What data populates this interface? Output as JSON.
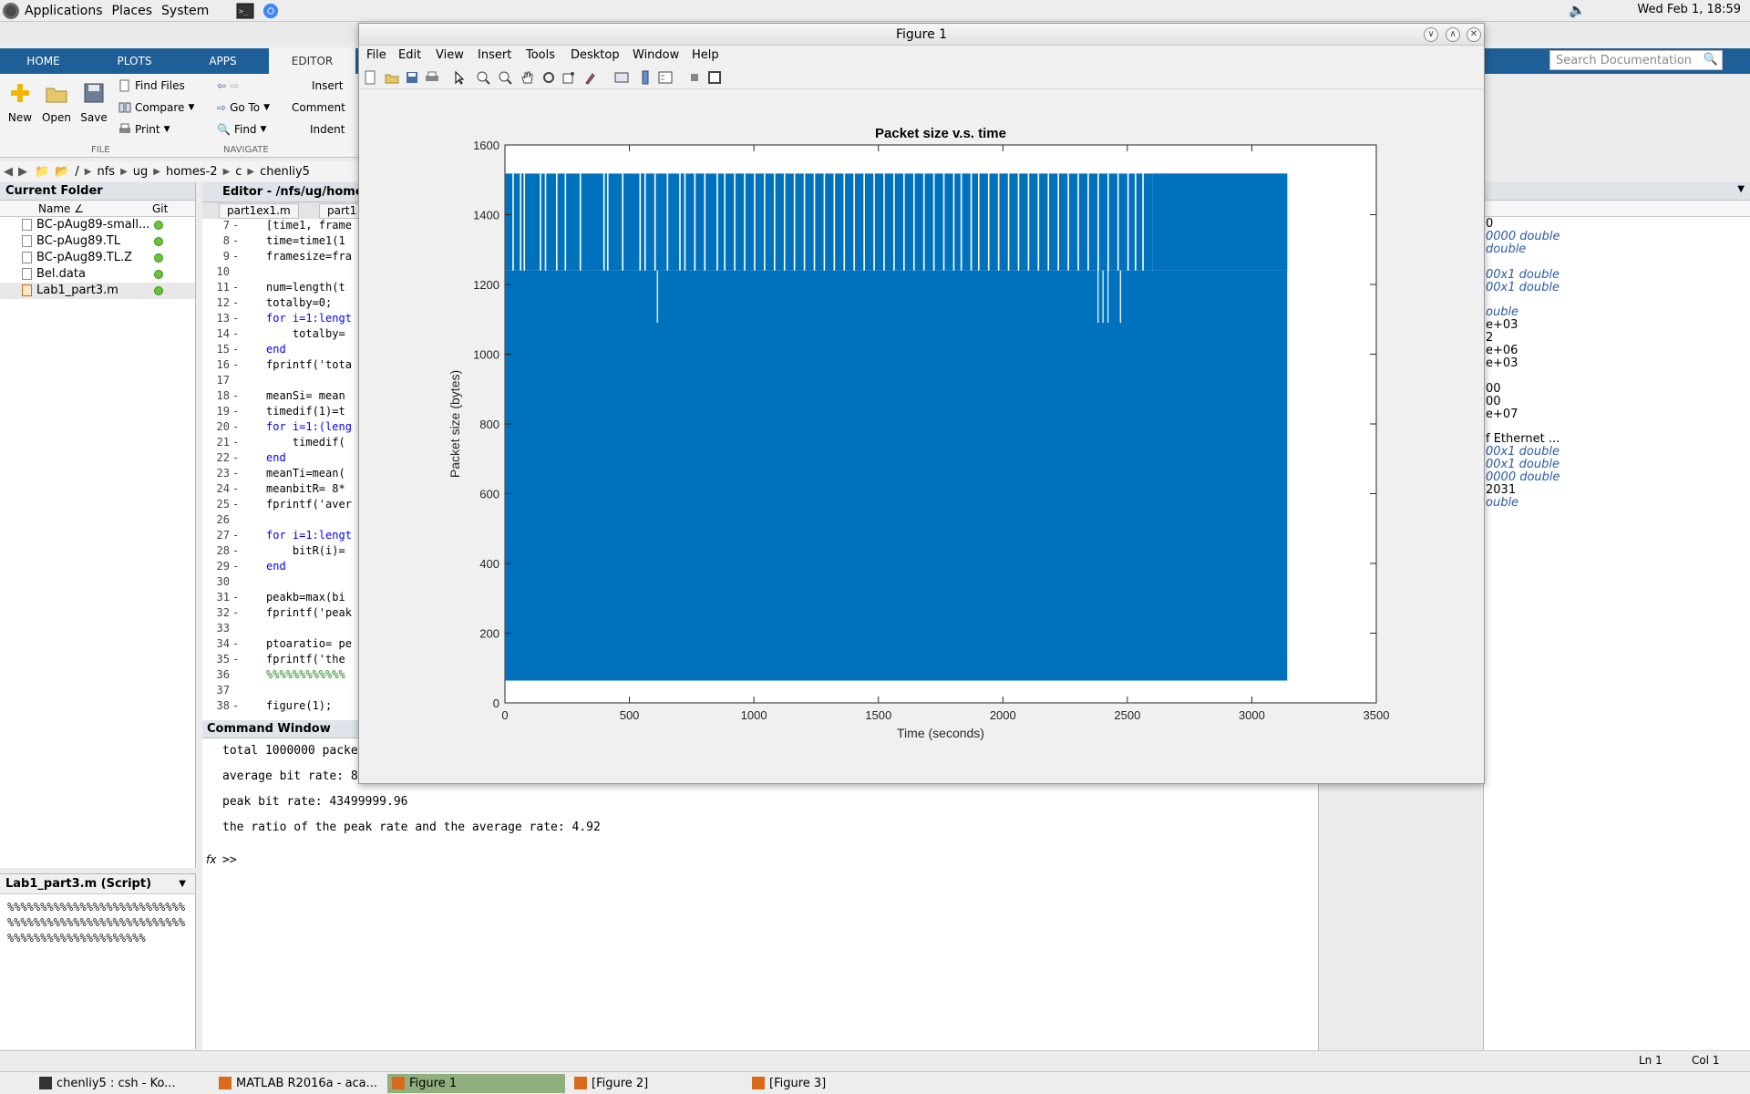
{
  "panel": {
    "applications": "Applications",
    "places": "Places",
    "system": "System",
    "clock": "Wed Feb  1, 18:59"
  },
  "ribbon": {
    "tabs": [
      "HOME",
      "PLOTS",
      "APPS",
      "EDITOR"
    ],
    "new_label": "New",
    "open_label": "Open",
    "save_label": "Save",
    "find_files": "Find Files",
    "compare": "Compare",
    "print": "Print",
    "go_to": "Go To",
    "find": "Find",
    "insert": "Insert",
    "comment": "Comment",
    "indent": "Indent",
    "group_file": "FILE",
    "group_navigate": "NAVIGATE"
  },
  "address": {
    "crumbs": [
      "/",
      "nfs",
      "ug",
      "homes-2",
      "c",
      "chenliy5"
    ]
  },
  "current_folder": {
    "title": "Current Folder",
    "col_name": "Name ∠",
    "col_git": "Git",
    "files": [
      "BC-pAug89-small...",
      "BC-pAug89.TL",
      "BC-pAug89.TL.Z",
      "Bel.data",
      "Lab1_part3.m"
    ]
  },
  "details": {
    "title": "Lab1_part3.m  (Script)",
    "content": "%%%%%%%%%%%%%%%%%%%%%%%%%%%%%%%%%%%%%%%%%%%%%%%%%%%%%%%%%%%%%%%%%%%%%%%%%%%"
  },
  "editor": {
    "title": "Editor - /nfs/ug/home",
    "tabs": [
      "part1ex1.m",
      "part1"
    ],
    "lines": [
      {
        "n": "7",
        "d": "-",
        "code": "[time1, frame"
      },
      {
        "n": "8",
        "d": "-",
        "code": "time=time1(1"
      },
      {
        "n": "9",
        "d": "-",
        "code": "framesize=fra"
      },
      {
        "n": "10",
        "d": "",
        "code": ""
      },
      {
        "n": "11",
        "d": "-",
        "code": "num=length(t"
      },
      {
        "n": "12",
        "d": "-",
        "code": "totalby=0;"
      },
      {
        "n": "13",
        "d": "-",
        "code": "for i=1:lengt"
      },
      {
        "n": "14",
        "d": "-",
        "code": "    totalby="
      },
      {
        "n": "15",
        "d": "-",
        "code": "end"
      },
      {
        "n": "16",
        "d": "-",
        "code": "fprintf('tota"
      },
      {
        "n": "17",
        "d": "",
        "code": ""
      },
      {
        "n": "18",
        "d": "-",
        "code": "meanSi= mean"
      },
      {
        "n": "19",
        "d": "-",
        "code": "timedif(1)=t"
      },
      {
        "n": "20",
        "d": "-",
        "code": "for i=1:(leng"
      },
      {
        "n": "21",
        "d": "-",
        "code": "    timedif("
      },
      {
        "n": "22",
        "d": "-",
        "code": "end"
      },
      {
        "n": "23",
        "d": "-",
        "code": "meanTi=mean("
      },
      {
        "n": "24",
        "d": "-",
        "code": "meanbitR= 8*"
      },
      {
        "n": "25",
        "d": "-",
        "code": "fprintf('aver"
      },
      {
        "n": "26",
        "d": "",
        "code": ""
      },
      {
        "n": "27",
        "d": "-",
        "code": "for i=1:lengt"
      },
      {
        "n": "28",
        "d": "-",
        "code": "    bitR(i)="
      },
      {
        "n": "29",
        "d": "-",
        "code": "end"
      },
      {
        "n": "30",
        "d": "",
        "code": ""
      },
      {
        "n": "31",
        "d": "-",
        "code": "peakb=max(bi"
      },
      {
        "n": "32",
        "d": "-",
        "code": "fprintf('peak"
      },
      {
        "n": "33",
        "d": "",
        "code": ""
      },
      {
        "n": "34",
        "d": "-",
        "code": "ptoaratio= pe"
      },
      {
        "n": "35",
        "d": "-",
        "code": "fprintf('the "
      },
      {
        "n": "36",
        "d": "",
        "code": "%%%%%%%%%%%%"
      },
      {
        "n": "37",
        "d": "",
        "code": ""
      },
      {
        "n": "38",
        "d": "-",
        "code": "figure(1);"
      }
    ]
  },
  "command_window": {
    "title": "Command Window",
    "lines": [
      "total 1000000 packe",
      "",
      "average bit rate: 8",
      "",
      "peak bit rate: 43499999.96",
      "",
      "the ratio of the peak rate and the average rate: 4.92"
    ],
    "fx": "fx",
    "prompt": ">>"
  },
  "workspace": {
    "rows": [
      {
        "text": "0",
        "italic": false
      },
      {
        "text": "0000 double",
        "italic": true
      },
      {
        "text": " double",
        "italic": true
      },
      {
        "text": "",
        "italic": false
      },
      {
        "text": "00x1 double",
        "italic": true
      },
      {
        "text": "00x1 double",
        "italic": true
      },
      {
        "text": "",
        "italic": false
      },
      {
        "text": "ouble",
        "italic": true
      },
      {
        "text": "e+03",
        "italic": false
      },
      {
        "text": "2",
        "italic": false
      },
      {
        "text": "e+06",
        "italic": false
      },
      {
        "text": "e+03",
        "italic": false
      },
      {
        "text": "",
        "italic": false
      },
      {
        "text": "00",
        "italic": false
      },
      {
        "text": "00",
        "italic": false
      },
      {
        "text": "e+07",
        "italic": false
      },
      {
        "text": "",
        "italic": false
      },
      {
        "text": "f Ethernet ...",
        "italic": false
      },
      {
        "text": "00x1 double",
        "italic": true
      },
      {
        "text": "00x1 double",
        "italic": true
      },
      {
        "text": "0000 double",
        "italic": true
      },
      {
        "text": "2031",
        "italic": false
      },
      {
        "text": "ouble",
        "italic": true
      }
    ]
  },
  "search": {
    "placeholder": "Search Documentation"
  },
  "status": {
    "ln": "Ln  1",
    "col": "Col  1"
  },
  "taskbar": {
    "items": [
      "chenliy5 : csh - Ko...",
      "MATLAB R2016a - aca...",
      "Figure 1",
      "[Figure 2]",
      "[Figure 3]"
    ]
  },
  "figure": {
    "window_title": "Figure 1",
    "menus": [
      "File",
      "Edit",
      "View",
      "Insert",
      "Tools",
      "Desktop",
      "Window",
      "Help"
    ]
  },
  "colors": {
    "series": "#0072bd",
    "ribbon": "#1f5f97"
  },
  "chart_data": {
    "type": "line",
    "title": "Packet size v.s. time",
    "xlabel": "Time (seconds)",
    "ylabel": "Packet size (bytes)",
    "xlim": [
      0,
      3500
    ],
    "ylim": [
      0,
      1600
    ],
    "xticks": [
      0,
      500,
      1000,
      1500,
      2000,
      2500,
      3000,
      3500
    ],
    "yticks": [
      0,
      200,
      400,
      600,
      800,
      1000,
      1200,
      1400,
      1600
    ],
    "grid": false,
    "series": [
      {
        "x_range": [
          0,
          3142
        ],
        "y_min": 64,
        "y_max": 1518,
        "dense_fill_floor": 1240,
        "dense_fill_floor_after_x": 2600,
        "notch_dips": [
          {
            "x": 610,
            "y": 1090
          },
          {
            "x": 2380,
            "y": 1090
          },
          {
            "x": 2400,
            "y": 1090
          },
          {
            "x": 2420,
            "y": 1090
          },
          {
            "x": 2470,
            "y": 1090
          }
        ],
        "gap_x": [
          30,
          60,
          75,
          140,
          160,
          205,
          240,
          300,
          395,
          410,
          470,
          540,
          560,
          600,
          650,
          700,
          720,
          760,
          800,
          850,
          880,
          920,
          960,
          1000,
          1040,
          1080,
          1120,
          1160,
          1200,
          1240,
          1280,
          1320,
          1360,
          1400,
          1440,
          1480,
          1520,
          1560,
          1600,
          1640,
          1680,
          1720,
          1760,
          1800,
          1830,
          1870,
          1900,
          1940,
          1980,
          2020,
          2060,
          2100,
          2140,
          2180,
          2220,
          2260,
          2300,
          2340,
          2380,
          2420,
          2460,
          2500,
          2530,
          2560,
          2600
        ]
      }
    ]
  }
}
